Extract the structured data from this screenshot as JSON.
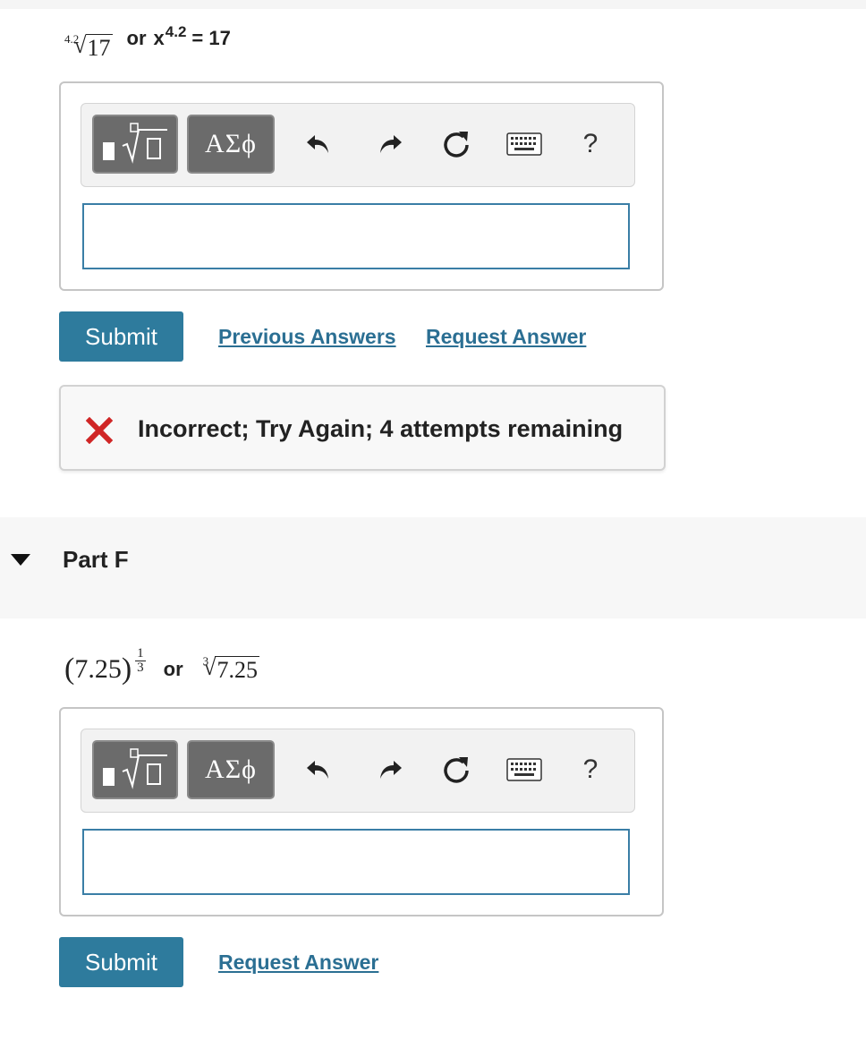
{
  "part_e": {
    "expr": {
      "root_index": "4.2",
      "radicand": "17",
      "or_text": "or",
      "base": "x",
      "exponent": "4.2",
      "equals": "= 17"
    },
    "toolbar": {
      "templates_icon": "templates-sqrt-icon",
      "greek_label": "ΑΣϕ",
      "help_label": "?"
    },
    "input_value": "",
    "submit_label": "Submit",
    "previous_answers_label": "Previous Answers",
    "request_answer_label": "Request Answer",
    "feedback": {
      "icon": "x-mark-icon",
      "text": "Incorrect; Try Again; 4 attempts remaining",
      "color": "#d02626"
    }
  },
  "part_f": {
    "title": "Part F",
    "expr": {
      "open": "(",
      "base": "7.25",
      "close": ")",
      "exp_num": "1",
      "exp_den": "3",
      "or_text": "or",
      "root_index": "3",
      "radicand": "7.25"
    },
    "toolbar": {
      "templates_icon": "templates-sqrt-icon",
      "greek_label": "ΑΣϕ",
      "help_label": "?"
    },
    "input_value": "",
    "submit_label": "Submit",
    "request_answer_label": "Request Answer"
  },
  "colors": {
    "accent": "#2e7b9d",
    "link": "#2b6f93",
    "error": "#d02626"
  }
}
